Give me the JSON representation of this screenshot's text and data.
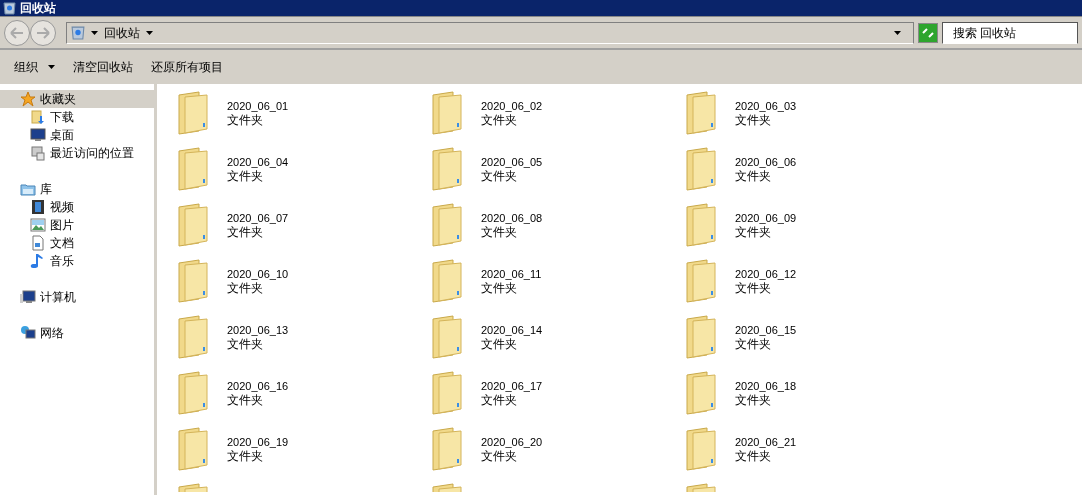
{
  "window": {
    "title": "回收站"
  },
  "address_bar": {
    "location": "回收站"
  },
  "search": {
    "placeholder": "搜索 回收站"
  },
  "toolbar": [
    {
      "label": "组织",
      "kind": "menu"
    },
    {
      "label": "清空回收站",
      "kind": "button"
    },
    {
      "label": "还原所有项目",
      "kind": "button"
    }
  ],
  "sidebar": [
    {
      "label": "收藏夹",
      "selected": true,
      "children": [
        {
          "label": "下载",
          "selected": false
        },
        {
          "label": "桌面",
          "selected": false
        },
        {
          "label": "最近访问的位置",
          "selected": false
        }
      ]
    },
    {
      "label": "库",
      "selected": false,
      "children": [
        {
          "label": "视频",
          "selected": false
        },
        {
          "label": "图片",
          "selected": false
        },
        {
          "label": "文档",
          "selected": false
        },
        {
          "label": "音乐",
          "selected": false
        }
      ]
    },
    {
      "label": "计算机",
      "selected": false
    },
    {
      "label": "网络",
      "selected": false
    }
  ],
  "items": [
    {
      "kind": "folder",
      "name": "2020_06_01",
      "type": "文件夹"
    },
    {
      "kind": "folder",
      "name": "2020_06_02",
      "type": "文件夹"
    },
    {
      "kind": "folder",
      "name": "2020_06_03",
      "type": "文件夹"
    },
    {
      "kind": "folder",
      "name": "2020_06_04",
      "type": "文件夹"
    },
    {
      "kind": "folder",
      "name": "2020_06_05",
      "type": "文件夹"
    },
    {
      "kind": "folder",
      "name": "2020_06_06",
      "type": "文件夹"
    },
    {
      "kind": "folder",
      "name": "2020_06_07",
      "type": "文件夹"
    },
    {
      "kind": "folder",
      "name": "2020_06_08",
      "type": "文件夹"
    },
    {
      "kind": "folder",
      "name": "2020_06_09",
      "type": "文件夹"
    },
    {
      "kind": "folder",
      "name": "2020_06_10",
      "type": "文件夹"
    },
    {
      "kind": "folder",
      "name": "2020_06_11",
      "type": "文件夹"
    },
    {
      "kind": "folder",
      "name": "2020_06_12",
      "type": "文件夹"
    },
    {
      "kind": "folder",
      "name": "2020_06_13",
      "type": "文件夹"
    },
    {
      "kind": "folder",
      "name": "2020_06_14",
      "type": "文件夹"
    },
    {
      "kind": "folder",
      "name": "2020_06_15",
      "type": "文件夹"
    },
    {
      "kind": "folder",
      "name": "2020_06_16",
      "type": "文件夹"
    },
    {
      "kind": "folder",
      "name": "2020_06_17",
      "type": "文件夹"
    },
    {
      "kind": "folder",
      "name": "2020_06_18",
      "type": "文件夹"
    },
    {
      "kind": "folder",
      "name": "2020_06_19",
      "type": "文件夹"
    },
    {
      "kind": "folder",
      "name": "2020_06_20",
      "type": "文件夹"
    },
    {
      "kind": "folder",
      "name": "2020_06_21",
      "type": "文件夹"
    },
    {
      "kind": "folder_cut"
    },
    {
      "kind": "folder_cut"
    },
    {
      "kind": "folder_cut"
    }
  ]
}
